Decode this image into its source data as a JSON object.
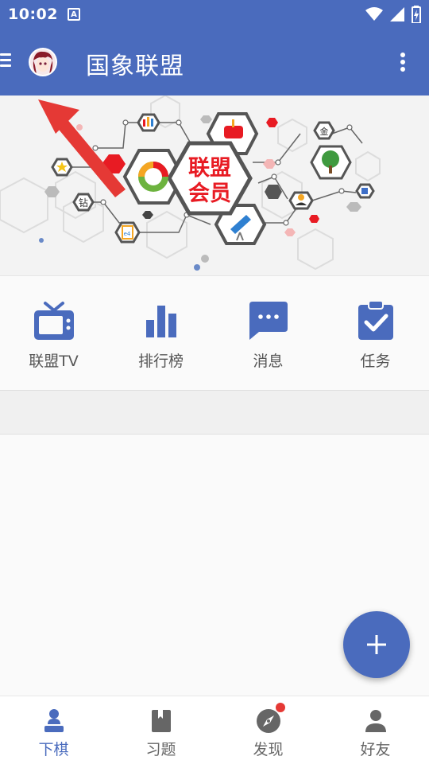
{
  "status_bar": {
    "time": "10:02",
    "a_icon": "A"
  },
  "app_bar": {
    "title": "国象联盟",
    "menu_icon": "menu-icon",
    "more_icon": "more-vert-icon"
  },
  "banner": {
    "line1": "联盟",
    "line2": "会员",
    "small_label_1": "钻",
    "small_label_2": "金",
    "small_label_3": "e4"
  },
  "quick_actions": [
    {
      "label": "联盟TV",
      "icon": "tv-icon"
    },
    {
      "label": "排行榜",
      "icon": "bar-chart-icon"
    },
    {
      "label": "消息",
      "icon": "message-icon"
    },
    {
      "label": "任务",
      "icon": "task-check-icon"
    }
  ],
  "fab": {
    "icon": "plus-icon"
  },
  "bottom_nav": [
    {
      "label": "下棋",
      "icon": "chess-pawn-icon",
      "active": true
    },
    {
      "label": "习题",
      "icon": "book-icon",
      "active": false
    },
    {
      "label": "发现",
      "icon": "compass-icon",
      "active": false,
      "badge": true
    },
    {
      "label": "好友",
      "icon": "person-icon",
      "active": false
    }
  ],
  "colors": {
    "primary": "#4a6bbd",
    "accent_red": "#e53935",
    "banner_red": "#e81b23"
  }
}
